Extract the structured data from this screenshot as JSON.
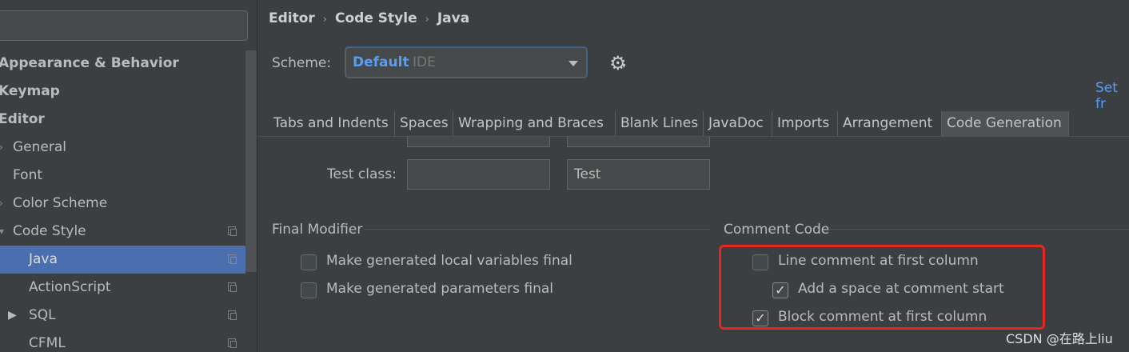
{
  "sidebar": {
    "search": {
      "value": ""
    },
    "items": [
      {
        "label": "Appearance & Behavior",
        "bold": true
      },
      {
        "label": "Keymap",
        "bold": true
      },
      {
        "label": "Editor",
        "bold": true
      },
      {
        "label": "General"
      },
      {
        "label": "Font"
      },
      {
        "label": "Color Scheme"
      },
      {
        "label": "Code Style"
      },
      {
        "label": "Java",
        "selected": true
      },
      {
        "label": "ActionScript"
      },
      {
        "label": "SQL"
      },
      {
        "label": "CFML"
      }
    ]
  },
  "breadcrumb": [
    "Editor",
    "Code Style",
    "Java"
  ],
  "scheme": {
    "label": "Scheme:",
    "name": "Default",
    "type": "IDE",
    "settings_icon": "gear-icon",
    "set_from_link": "Set fr"
  },
  "tabs": [
    {
      "label": "Tabs and Indents"
    },
    {
      "label": "Spaces"
    },
    {
      "label": "Wrapping and Braces"
    },
    {
      "label": "Blank Lines"
    },
    {
      "label": "JavaDoc"
    },
    {
      "label": "Imports"
    },
    {
      "label": "Arrangement"
    },
    {
      "label": "Code Generation",
      "active": true
    }
  ],
  "code_generation": {
    "test_class": {
      "label": "Test class:",
      "prefix": "",
      "suffix": "Test"
    },
    "final_modifier": {
      "title": "Final Modifier",
      "options": [
        {
          "label": "Make generated local variables final",
          "checked": false
        },
        {
          "label": "Make generated parameters final",
          "checked": false
        }
      ]
    },
    "comment_code": {
      "title": "Comment Code",
      "options": [
        {
          "label": "Line comment at first column",
          "checked": false
        },
        {
          "label": "Add a space at comment start",
          "checked": true
        },
        {
          "label": "Block comment at first column",
          "checked": true
        }
      ]
    }
  },
  "watermark": "CSDN @在路上liu",
  "colors": {
    "background": "#3c3f41",
    "selection": "#4b6eaf",
    "link": "#589df6",
    "highlight": "#e8281e"
  }
}
